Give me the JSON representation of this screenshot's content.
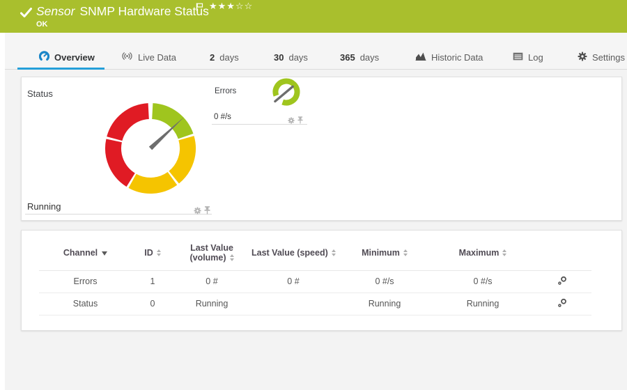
{
  "header": {
    "kind": "Sensor",
    "title": "SNMP Hardware Status",
    "status": "OK",
    "stars_filled": "★★★",
    "stars_empty": "☆☆",
    "bg_color": "#a9bf2d"
  },
  "tabs": [
    {
      "label": "Overview",
      "active": true
    },
    {
      "label": "Live Data"
    },
    {
      "prefix": "2",
      "label": "days"
    },
    {
      "prefix": "30",
      "label": "days"
    },
    {
      "prefix": "365",
      "label": "days"
    },
    {
      "label": "Historic Data"
    },
    {
      "label": "Log"
    },
    {
      "label": "Settings"
    }
  ],
  "gauges": {
    "status": {
      "label": "Status",
      "value": "Running",
      "needle_angle": 47,
      "segments": [
        {
          "color": "#9fc51e",
          "start": 3,
          "end": 71
        },
        {
          "color": "#f5c400",
          "start": 74,
          "end": 141
        },
        {
          "color": "#f5c400",
          "start": 144,
          "end": 209
        },
        {
          "color": "#e01b24",
          "start": 212,
          "end": 282
        },
        {
          "color": "#e01b24",
          "start": 285,
          "end": 357
        }
      ]
    },
    "errors": {
      "label": "Errors",
      "value": "0 #/s",
      "arc": {
        "color": "#9fc51e",
        "start": 250,
        "end": 560
      },
      "needle_angle": 50
    }
  },
  "table": {
    "columns": [
      {
        "label": "Channel",
        "sorted": "desc"
      },
      {
        "label": "ID"
      },
      {
        "label": "Last Value (volume)"
      },
      {
        "label": "Last Value (speed)"
      },
      {
        "label": "Minimum"
      },
      {
        "label": "Maximum"
      }
    ],
    "rows": [
      {
        "channel": "Errors",
        "id": "1",
        "last_value_volume": "0 #",
        "last_value_speed": "0 #",
        "minimum": "0 #/s",
        "maximum": "0 #/s"
      },
      {
        "channel": "Status",
        "id": "0",
        "last_value_volume": "Running",
        "last_value_speed": "",
        "minimum": "Running",
        "maximum": "Running"
      }
    ]
  },
  "icons": {
    "check": "status-ok-checkmark",
    "flag": "priority-flag",
    "gauge": "overview-dial",
    "broadcast": "live-data-signal",
    "area_chart": "historic-data-chart",
    "log": "log-list",
    "gear": "settings-gear",
    "pin": "pushpin",
    "channel_settings": "channel-settings-gears"
  }
}
